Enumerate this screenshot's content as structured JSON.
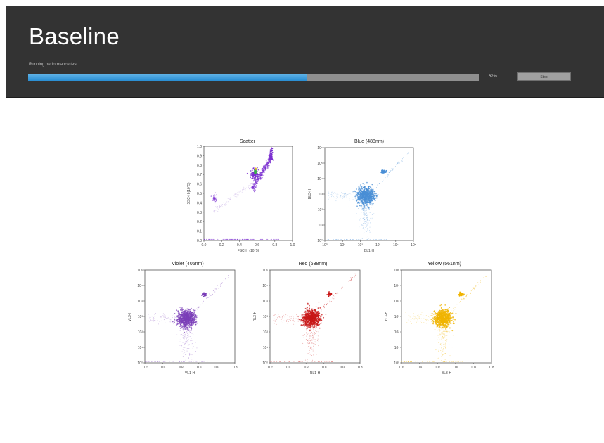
{
  "window": {
    "title": "Baseline",
    "status_text": "Running performance test...",
    "progress_percent": 62,
    "progress_label": "62%",
    "stop_button_label": "Stop"
  },
  "colors": {
    "header_bg": "#333333",
    "progress_fill": "#2a8ed3",
    "progress_track": "#8f8f8f",
    "scatter": "#7b2fd0",
    "blue": "#4a8fd6",
    "violet": "#7b3fb8",
    "red": "#c81818",
    "yellow": "#f0b400"
  },
  "plots": {
    "scatter": {
      "title": "Scatter",
      "xlabel": "FSC-H (10^5)",
      "ylabel": "SSC-H (10^5)",
      "x_ticks": [
        "0.0",
        "0.2",
        "0.4",
        "0.6",
        "0.8",
        "1.0"
      ],
      "y_ticks": [
        "0.0",
        "0.1",
        "0.2",
        "0.3",
        "0.4",
        "0.5",
        "0.6",
        "0.7",
        "0.8",
        "0.9",
        "1.0"
      ]
    },
    "blue": {
      "title": "Blue (488nm)",
      "xlabel": "BL1-H",
      "ylabel": "BL3-H",
      "x_ticks": [
        "10⁰",
        "10¹",
        "10²",
        "10³",
        "10⁴",
        "10⁵"
      ],
      "y_ticks": [
        "10⁰",
        "10¹",
        "10²",
        "10³",
        "10⁴",
        "10⁵",
        "10⁶"
      ]
    },
    "violet": {
      "title": "Violet (405nm)",
      "xlabel": "VL1-H",
      "ylabel": "VL3-H",
      "x_ticks": [
        "10⁰",
        "10¹",
        "10²",
        "10³",
        "10⁴",
        "10⁵"
      ],
      "y_ticks": [
        "10⁰",
        "10¹",
        "10²",
        "10³",
        "10⁴",
        "10⁵",
        "10⁶"
      ]
    },
    "red": {
      "title": "Red (638nm)",
      "xlabel": "RL1-H",
      "ylabel": "RL3-H",
      "x_ticks": [
        "10⁰",
        "10¹",
        "10²",
        "10³",
        "10⁴",
        "10⁵"
      ],
      "y_ticks": [
        "10⁰",
        "10¹",
        "10²",
        "10³",
        "10⁴",
        "10⁵",
        "10⁶"
      ]
    },
    "yellow": {
      "title": "Yellow (561nm)",
      "xlabel": "BL3-H",
      "ylabel": "YL3-H",
      "x_ticks": [
        "10⁰",
        "10¹",
        "10²",
        "10³",
        "10⁴",
        "10⁵"
      ],
      "y_ticks": [
        "10⁰",
        "10¹",
        "10²",
        "10³",
        "10⁴",
        "10⁵",
        "10⁶"
      ]
    }
  }
}
